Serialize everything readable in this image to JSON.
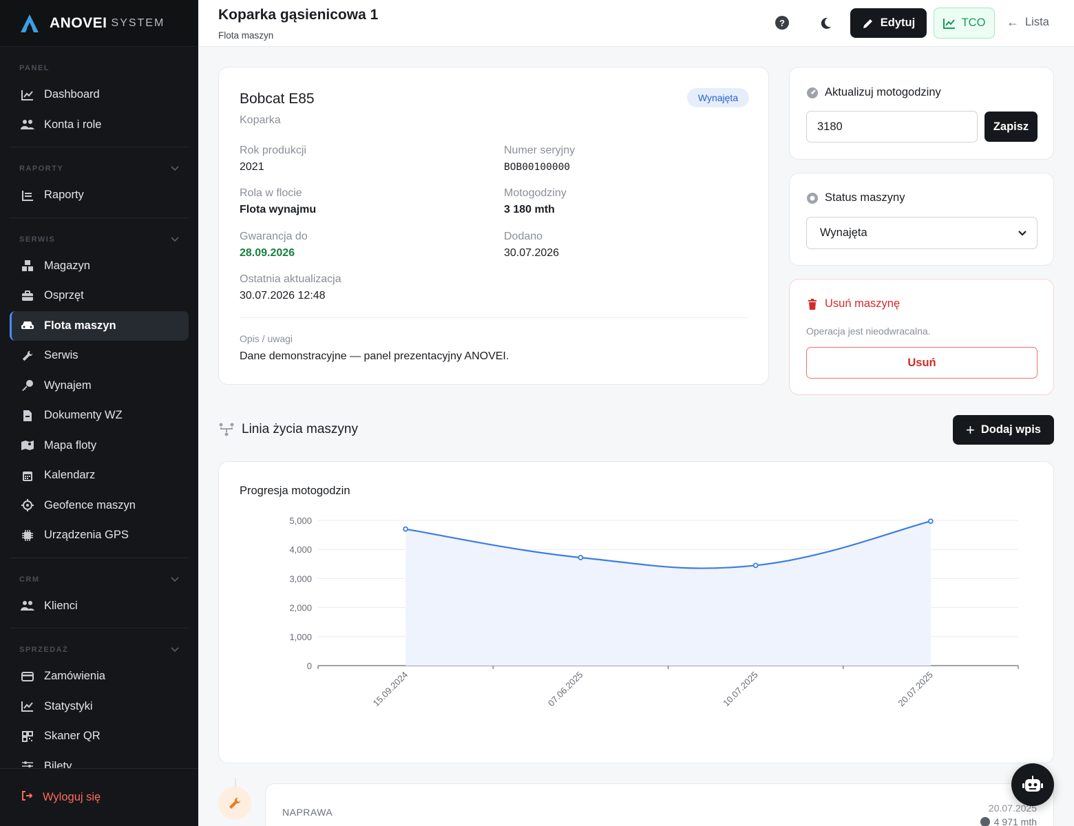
{
  "brand": {
    "name": "ANOVEI",
    "suffix": "SYSTEM"
  },
  "sidebar": {
    "sections": [
      {
        "title": "PANEL",
        "items": [
          {
            "label": "Dashboard",
            "icon": "chart-line-icon"
          },
          {
            "label": "Konta i role",
            "icon": "users-icon"
          }
        ]
      },
      {
        "title": "RAPORTY",
        "items": [
          {
            "label": "Raporty",
            "icon": "list-icon"
          }
        ]
      },
      {
        "title": "SERWIS",
        "items": [
          {
            "label": "Magazyn",
            "icon": "boxes-icon"
          },
          {
            "label": "Osprzęt",
            "icon": "toolbox-icon"
          },
          {
            "label": "Flota maszyn",
            "icon": "car-icon",
            "active": true
          },
          {
            "label": "Serwis",
            "icon": "wrench-icon"
          },
          {
            "label": "Wynajem",
            "icon": "key-icon"
          },
          {
            "label": "Dokumenty WZ",
            "icon": "file-icon"
          },
          {
            "label": "Mapa floty",
            "icon": "map-icon"
          },
          {
            "label": "Kalendarz",
            "icon": "calendar-icon"
          },
          {
            "label": "Geofence maszyn",
            "icon": "crosshair-icon"
          },
          {
            "label": "Urządzenia GPS",
            "icon": "chip-icon"
          }
        ]
      },
      {
        "title": "CRM",
        "items": [
          {
            "label": "Klienci",
            "icon": "users-icon"
          }
        ]
      },
      {
        "title": "SPRZEDAŻ",
        "items": [
          {
            "label": "Zamówienia",
            "icon": "card-icon"
          },
          {
            "label": "Statystyki",
            "icon": "chart-line-icon"
          },
          {
            "label": "Skaner QR",
            "icon": "qr-icon"
          },
          {
            "label": "Bilety",
            "icon": "sliders-icon"
          }
        ]
      }
    ],
    "logout": "Wyloguj się"
  },
  "header": {
    "title": "Koparka gąsienicowa 1",
    "subtitle": "Flota maszyn",
    "help": "?",
    "edit": "Edytuj",
    "tco": "TCO",
    "list": "Lista"
  },
  "machine": {
    "name": "Bobcat E85",
    "type": "Koparka",
    "status_badge": "Wynajęta",
    "fields": {
      "year_label": "Rok produkcji",
      "year": "2021",
      "serial_label": "Numer seryjny",
      "serial": "BOB00100000",
      "role_label": "Rola w flocie",
      "role": "Flota wynajmu",
      "hours_label": "Motogodziny",
      "hours": "3 180 mth",
      "warranty_label": "Gwarancja do",
      "warranty": "28.09.2026",
      "added_label": "Dodano",
      "added": "30.07.2026",
      "updated_label": "Ostatnia aktualizacja",
      "updated": "30.07.2026 12:48"
    },
    "notes_label": "Opis / uwagi",
    "notes": "Dane demonstracyjne — panel prezentacyjny ANOVEI."
  },
  "hours_form": {
    "title": "Aktualizuj motogodziny",
    "value": "3180",
    "save": "Zapisz"
  },
  "status_form": {
    "title": "Status maszyny",
    "selected": "Wynajęta"
  },
  "delete_form": {
    "title": "Usuń maszynę",
    "note": "Operacja jest nieodwracalna.",
    "button": "Usuń"
  },
  "lifeline": {
    "title": "Linia życia maszyny",
    "add": "Dodaj wpis"
  },
  "chart_data": {
    "type": "area",
    "title": "Progresja motogodzin",
    "categories": [
      "15.09.2024",
      "07.06.2025",
      "10.07.2025",
      "20.07.2025"
    ],
    "values": [
      4700,
      3720,
      3450,
      4971
    ],
    "ylim": [
      0,
      5000
    ],
    "yticks": [
      "0",
      "1,000",
      "2,000",
      "3,000",
      "4,000",
      "5,000"
    ],
    "grid": true,
    "color": "#3b7de0"
  },
  "entry": {
    "type": "NAPRAWA",
    "date": "20.07.2025",
    "hours": "4 971 mth"
  },
  "colors": {
    "accent": "#4c8bf5",
    "danger": "#d32a2a",
    "success": "#18803f"
  }
}
